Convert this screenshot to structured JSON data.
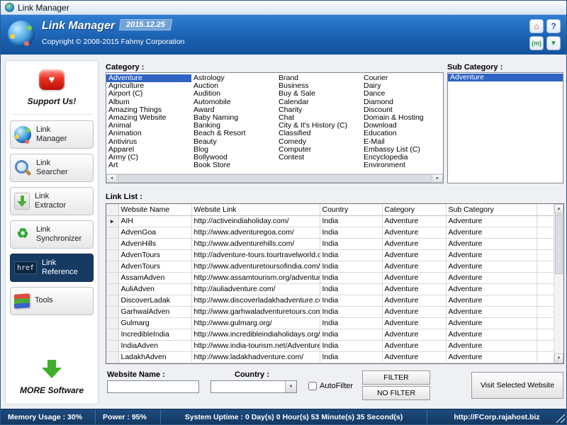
{
  "titlebar": {
    "title": "Link Manager"
  },
  "header": {
    "title": "Link Manager",
    "version": "2015.12.25",
    "copyright": "Copyright © 2008-2015 Fahmy Corporation",
    "icons": [
      {
        "id": "home",
        "glyph": "⌂"
      },
      {
        "id": "help",
        "glyph": "?"
      },
      {
        "id": "messenger",
        "glyph": "(m)"
      },
      {
        "id": "update-download",
        "glyph": "▼"
      }
    ]
  },
  "sidebar": {
    "support_label": "Support Us!",
    "support_glyph": "♥",
    "items": [
      {
        "id": "manager",
        "label": "Link Manager",
        "icon": "globe-links-icon",
        "glyph": "",
        "selected": false
      },
      {
        "id": "searcher",
        "label": "Link Searcher",
        "icon": "magnifier-icon",
        "glyph": "",
        "selected": false
      },
      {
        "id": "extractor",
        "label": "Link Extractor",
        "icon": "extract-arrow-icon",
        "glyph": "",
        "selected": false
      },
      {
        "id": "synchronizer",
        "label": "Link Synchronizer",
        "icon": "sync-arrows-icon",
        "glyph": "♻",
        "selected": false
      },
      {
        "id": "reference",
        "label": "Link Reference",
        "icon": "href-icon",
        "glyph": "href",
        "selected": true
      },
      {
        "id": "tools",
        "label": "Tools",
        "icon": "tools-blocks-icon",
        "glyph": "",
        "selected": false
      }
    ],
    "more_label": "MORE Software"
  },
  "category": {
    "label": "Category :",
    "selected": "Adventure",
    "columns": [
      [
        "Adventure",
        "Agriculture",
        "Airport (C)",
        "Album",
        "Amazing Things",
        "Amazing Website",
        "Animal",
        "Animation",
        "Antivirus",
        "Apparel",
        "Army (C)",
        "Art"
      ],
      [
        "Astrology",
        "Auction",
        "Audition",
        "Automobile",
        "Award",
        "Baby Naming",
        "Banking",
        "Beach & Resort",
        "Beauty",
        "Blog",
        "Bollywood",
        "Book Store"
      ],
      [
        "Brand",
        "Business",
        "Buy & Sale",
        "Calendar",
        "Charity",
        "Chat",
        "City & It's History (C)",
        "Classified",
        "Comedy",
        "Computer",
        "Contest"
      ],
      [
        "Courier",
        "Dairy",
        "Dance",
        "Diamond",
        "Discount",
        "Domain & Hosting",
        "Download",
        "Education",
        "E-Mail",
        "Embassy List (C)",
        "Encyclopedia",
        "Environment"
      ]
    ]
  },
  "subcategory": {
    "label": "Sub Category :",
    "selected": "Adventure",
    "items": [
      "Adventure"
    ]
  },
  "linklist": {
    "label": "Link List :",
    "columns": [
      "Website Name",
      "Website Link",
      "Country",
      "Category",
      "Sub Category"
    ],
    "rows": [
      [
        "AIH",
        "http://activeindiaholiday.com/",
        "India",
        "Adventure",
        "Adventure"
      ],
      [
        "AdvenGoa",
        "http://www.adventuregoa.com/",
        "India",
        "Adventure",
        "Adventure"
      ],
      [
        "AdvenHills",
        "http://www.adventurehills.com/",
        "India",
        "Adventure",
        "Adventure"
      ],
      [
        "AdvenTours",
        "http://adventure-tours.tourtravelworld.com",
        "India",
        "Adventure",
        "Adventure"
      ],
      [
        "AdvenTours",
        "http://www.adventuretoursofindia.com/ad",
        "India",
        "Adventure",
        "Adventure"
      ],
      [
        "AssamAdven",
        "http://www.assamtourism.org/adventure.p",
        "India",
        "Adventure",
        "Adventure"
      ],
      [
        "AuliAdven",
        "http://auliadventure.com/",
        "India",
        "Adventure",
        "Adventure"
      ],
      [
        "DiscoverLadak",
        "http://www.discoverladakhadventure.com",
        "India",
        "Adventure",
        "Adventure"
      ],
      [
        "GarhwalAdven",
        "http://www.garhwaladventuretours.com/",
        "India",
        "Adventure",
        "Adventure"
      ],
      [
        "Gulmarg",
        "http://www.gulmarg.org/",
        "India",
        "Adventure",
        "Adventure"
      ],
      [
        "IncredibleIndia",
        "http://www.incredibleindiaholidays.org/",
        "India",
        "Adventure",
        "Adventure"
      ],
      [
        "IndiaAdven",
        "http://www.india-tourism.net/Adventures.",
        "India",
        "Adventure",
        "Adventure"
      ],
      [
        "LadakhAdven",
        "http://www.ladakhadventure.com/",
        "India",
        "Adventure",
        "Adventure"
      ]
    ],
    "current_row_marker": "►"
  },
  "filterbar": {
    "website_name_label": "Website Name :",
    "website_name_value": "",
    "country_label": "Country :",
    "country_value": "",
    "autofilter_label": "AutoFilter",
    "filter_button": "FILTER",
    "no_filter_button": "NO FILTER",
    "visit_button": "Visit Selected Website"
  },
  "scrollbar": {
    "left": "◄",
    "right": "►",
    "up": "▲",
    "down": "▼"
  },
  "statusbar": {
    "memory": "Memory Usage : 30%",
    "power": "Power : 95%",
    "uptime": "System Uptime : 0 Day(s) 0 Hour(s) 53 Minute(s) 35 Second(s)",
    "url": "http://FCorp.rajahost.biz"
  }
}
